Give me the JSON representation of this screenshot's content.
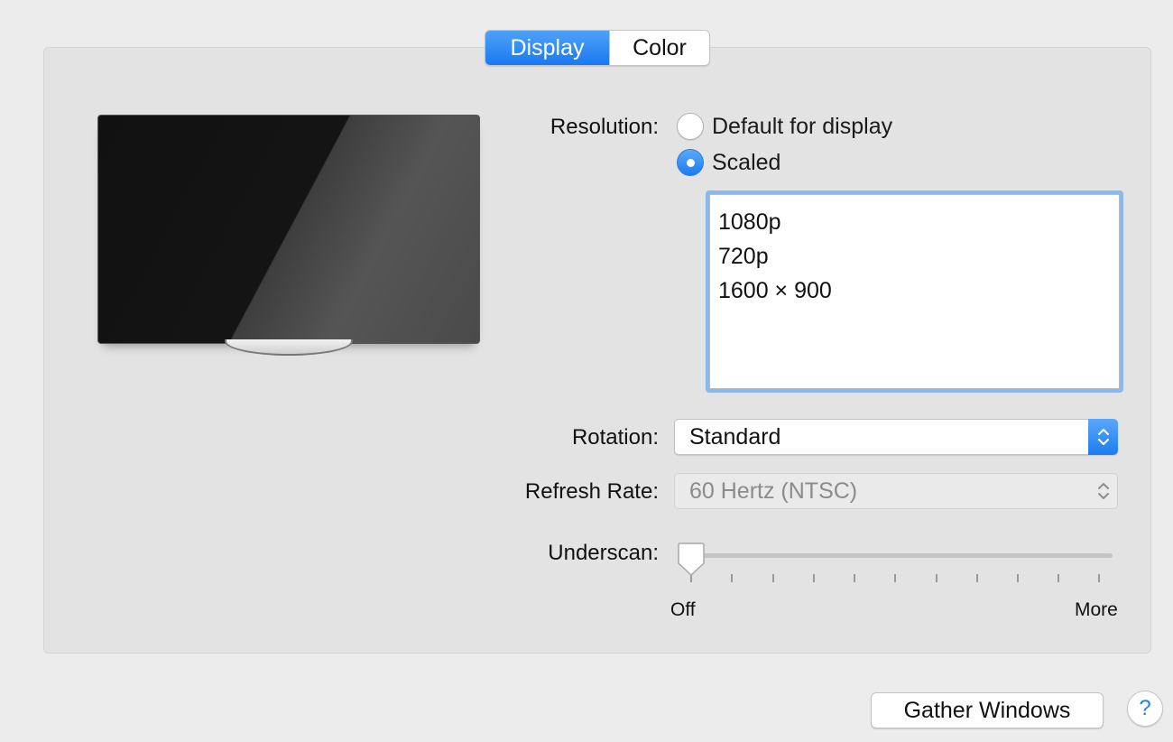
{
  "tabs": [
    {
      "label": "Display",
      "active": true
    },
    {
      "label": "Color",
      "active": false
    }
  ],
  "resolution": {
    "label": "Resolution:",
    "options": [
      {
        "label": "Default for display",
        "selected": false
      },
      {
        "label": "Scaled",
        "selected": true
      }
    ],
    "scaled_list": [
      "1080p",
      "720p",
      "1600 × 900"
    ]
  },
  "rotation": {
    "label": "Rotation:",
    "value": "Standard"
  },
  "refresh_rate": {
    "label": "Refresh Rate:",
    "value": "60 Hertz (NTSC)",
    "enabled": false
  },
  "underscan": {
    "label": "Underscan:",
    "min_label": "Off",
    "max_label": "More",
    "value": 0
  },
  "footer": {
    "gather_windows": "Gather Windows",
    "help": "?"
  },
  "colors": {
    "accent": "#1a79ef",
    "focus_ring": "#8ab8f1"
  },
  "icons": {
    "monitor": "display-monitor-icon",
    "stepper": "up-down-chevron-icon",
    "help": "question-mark-icon"
  }
}
